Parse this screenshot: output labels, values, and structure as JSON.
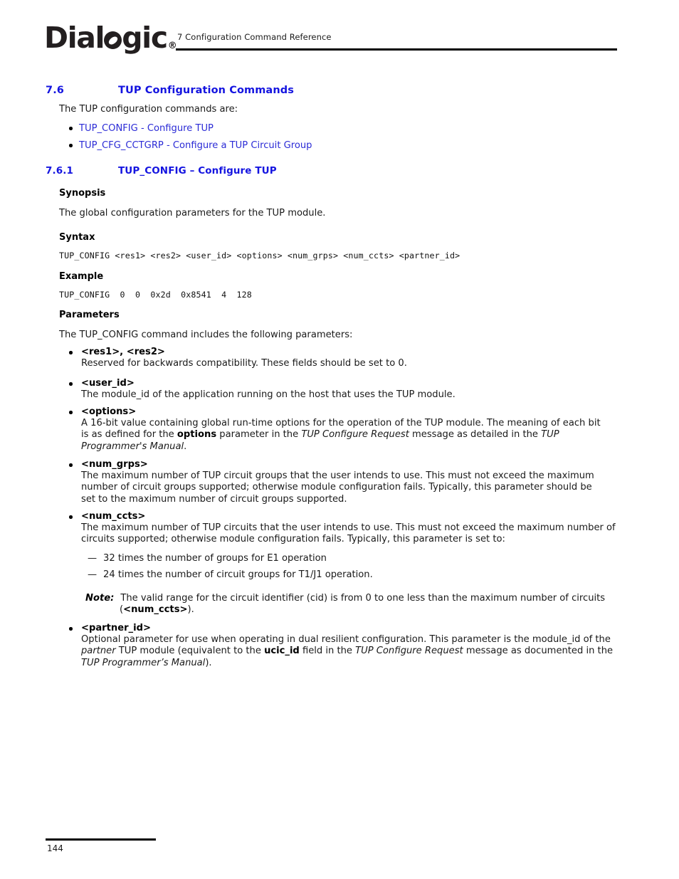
{
  "header": {
    "logo_text_1": "Dial",
    "logo_text_2": "gic",
    "logo_mark": "®",
    "running_title": "7 Configuration Command Reference"
  },
  "section": {
    "number": "7.6",
    "title": "TUP Configuration Commands",
    "intro": "The TUP configuration commands are:",
    "links": [
      "TUP_CONFIG - Configure TUP",
      "TUP_CFG_CCTGRP - Configure a TUP Circuit Group"
    ]
  },
  "subsection": {
    "number": "7.6.1",
    "title": "TUP_CONFIG – Configure TUP",
    "synopsis_heading": "Synopsis",
    "synopsis_text": "The global configuration parameters for the TUP module.",
    "syntax_heading": "Syntax",
    "syntax_code": "TUP_CONFIG <res1> <res2> <user_id> <options> <num_grps> <num_ccts> <partner_id>",
    "example_heading": "Example",
    "example_code": "TUP_CONFIG  0  0  0x2d  0x8541  4  128",
    "parameters_heading": "Parameters",
    "parameters_intro": "The TUP_CONFIG command includes the following parameters:"
  },
  "parameters": [
    {
      "term": "<res1>, <res2>",
      "desc": "Reserved for backwards compatibility. These fields should be set to 0."
    },
    {
      "term": "<user_id>",
      "desc": "The module_id of the application running on the host that uses the TUP module."
    },
    {
      "term": "<options>",
      "desc_part1": "A 16-bit value containing global run-time options for the operation of the TUP module. The meaning of each bit is as defined for the ",
      "desc_bold1": "options",
      "desc_part2": " parameter in the ",
      "desc_italic1": "TUP Configure Request",
      "desc_part3": " message as detailed in the ",
      "desc_italic2": "TUP Programmer's Manual",
      "desc_part4": "."
    },
    {
      "term": "<num_grps>",
      "desc": "The maximum number of TUP circuit groups that the user intends to use. This must not exceed the maximum number of circuit groups supported; otherwise module configuration fails. Typically, this parameter should be set to the maximum number of circuit groups supported."
    },
    {
      "term": "<num_ccts>",
      "desc": "The maximum number of TUP circuits that the user intends to use. This must not exceed the maximum number of circuits supported; otherwise module configuration fails. Typically, this parameter is set to:"
    },
    {
      "term": "<partner_id>",
      "desc_part1": "Optional parameter for use when operating in dual resilient configuration. This parameter is the module_id of the ",
      "desc_italic1": "partner",
      "desc_part2": " TUP module (equivalent to the ",
      "desc_bold1": "ucic_id",
      "desc_part3": " field in the ",
      "desc_italic2": "TUP Configure Request",
      "desc_part4": " message as documented in the ",
      "desc_italic3": "TUP Programmer’s Manual",
      "desc_part5": ")."
    }
  ],
  "sub_list": [
    {
      "marker": "—",
      "text": "32 times the number of groups for E1 operation"
    },
    {
      "marker": "—",
      "text": "24 times the number of circuit groups for T1/J1 operation."
    }
  ],
  "note": {
    "label": "Note:",
    "text_part1": "The valid range for the circuit identifier (cid) is from 0 to one less than the maximum number of circuits (",
    "text_bold": "<num_ccts>",
    "text_part2": ")."
  },
  "footer": {
    "page_number": "144"
  },
  "colors": {
    "heading_blue": "#1414e0",
    "link_blue": "#2b2bd6",
    "body_black": "#1a1a1a"
  }
}
